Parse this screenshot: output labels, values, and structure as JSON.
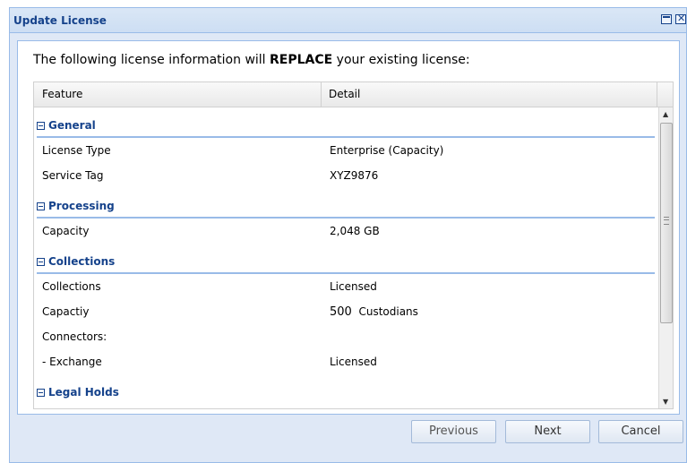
{
  "window": {
    "title": "Update License",
    "maximize_icon": "maximize-icon",
    "close_icon": "close-icon",
    "close_glyph": "✕"
  },
  "intro": {
    "before": "The following license information will ",
    "emphasis": "REPLACE",
    "after": " your existing license:"
  },
  "grid": {
    "columns": [
      "Feature",
      "Detail"
    ],
    "groups": [
      {
        "name": "General",
        "rows": [
          {
            "feature": "License Type",
            "detail": "Enterprise (Capacity)"
          },
          {
            "feature": "Service Tag",
            "detail": "XYZ9876"
          }
        ]
      },
      {
        "name": "Processing",
        "rows": [
          {
            "feature": "Capacity",
            "detail": "2,048 GB"
          }
        ]
      },
      {
        "name": "Collections",
        "rows": [
          {
            "feature": "Collections",
            "detail": "Licensed"
          },
          {
            "feature": "Capactiy",
            "detail_num": "500",
            "detail": "Custodians"
          },
          {
            "feature": "Connectors:",
            "detail": ""
          },
          {
            "feature": "- Exchange",
            "detail": "Licensed"
          }
        ]
      },
      {
        "name": "Legal Holds",
        "rows": []
      }
    ]
  },
  "buttons": {
    "previous": "Previous",
    "next": "Next",
    "cancel": "Cancel"
  }
}
